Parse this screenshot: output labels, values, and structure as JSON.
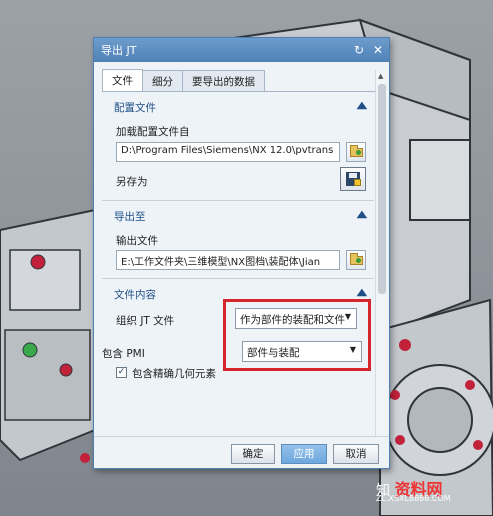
{
  "window": {
    "title": "导出 JT",
    "reset_glyph": "↻",
    "close_glyph": "✕"
  },
  "tabs": [
    {
      "label": "文件",
      "active": true
    },
    {
      "label": "细分",
      "active": false
    },
    {
      "label": "要导出的数据",
      "active": false
    }
  ],
  "sections": {
    "config": {
      "header": "配置文件",
      "load_label": "加载配置文件自",
      "load_path": "D:\\Program Files\\Siemens\\NX 12.0\\pvtrans",
      "save_as_label": "另存为"
    },
    "export_to": {
      "header": "导出至",
      "output_label": "输出文件",
      "output_path": "E:\\工作文件夹\\三维模型\\NX图档\\装配体\\Jian"
    },
    "file_content": {
      "header": "文件内容",
      "organize_label": "组织 JT 文件",
      "organize_value": "作为部件的装配和文件",
      "pmi_label": "包含 PMI",
      "pmi_value": "部件与装配",
      "precise_geom_label": "包含精确几何元素",
      "precise_geom_checked": true
    }
  },
  "collapse_glyph": "▲",
  "footer": {
    "ok_label": "确定",
    "apply_label": "应用",
    "cancel_label": "取消"
  },
  "watermark": {
    "prefix": "知",
    "brand": "资料网",
    "url": "ZL.XSXL8888.COM"
  },
  "colors": {
    "accent": "#4f82b7",
    "highlight": "#d6262d",
    "section_header": "#1e4f86"
  }
}
